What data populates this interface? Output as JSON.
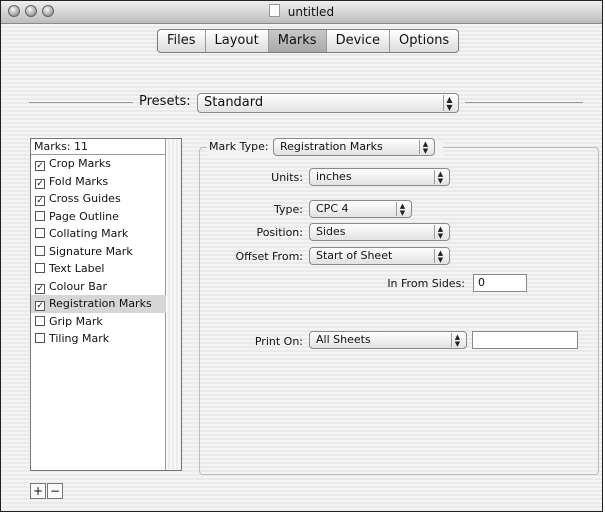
{
  "window": {
    "title": "untitled"
  },
  "tabs": [
    {
      "label": "Files",
      "selected": false
    },
    {
      "label": "Layout",
      "selected": false
    },
    {
      "label": "Marks",
      "selected": true
    },
    {
      "label": "Device",
      "selected": false
    },
    {
      "label": "Options",
      "selected": false
    }
  ],
  "presets": {
    "label": "Presets:",
    "value": "Standard"
  },
  "marks": {
    "header": "Marks: 11",
    "items": [
      {
        "label": "Crop Marks",
        "checked": true
      },
      {
        "label": "Fold Marks",
        "checked": true
      },
      {
        "label": "Cross Guides",
        "checked": true
      },
      {
        "label": "Page Outline",
        "checked": false
      },
      {
        "label": "Collating Mark",
        "checked": false
      },
      {
        "label": "Signature Mark",
        "checked": false
      },
      {
        "label": "Text Label",
        "checked": false
      },
      {
        "label": "Colour Bar",
        "checked": true
      },
      {
        "label": "Registration Marks",
        "checked": true,
        "selected": true
      },
      {
        "label": "Grip Mark",
        "checked": false
      },
      {
        "label": "Tiling Mark",
        "checked": false
      }
    ],
    "add_label": "+",
    "remove_label": "−"
  },
  "detail": {
    "mark_type": {
      "label": "Mark Type:",
      "value": "Registration Marks"
    },
    "units": {
      "label": "Units:",
      "value": "inches"
    },
    "type": {
      "label": "Type:",
      "value": "CPC 4"
    },
    "position": {
      "label": "Position:",
      "value": "Sides"
    },
    "offset_from": {
      "label": "Offset From:",
      "value": "Start of Sheet"
    },
    "in_from_sides": {
      "label": "In From Sides:",
      "value": "0"
    },
    "print_on": {
      "label": "Print On:",
      "value": "All Sheets",
      "extra_value": ""
    }
  },
  "glyphs": {
    "popup_arrows": "▲\n▼",
    "check": "✓"
  }
}
